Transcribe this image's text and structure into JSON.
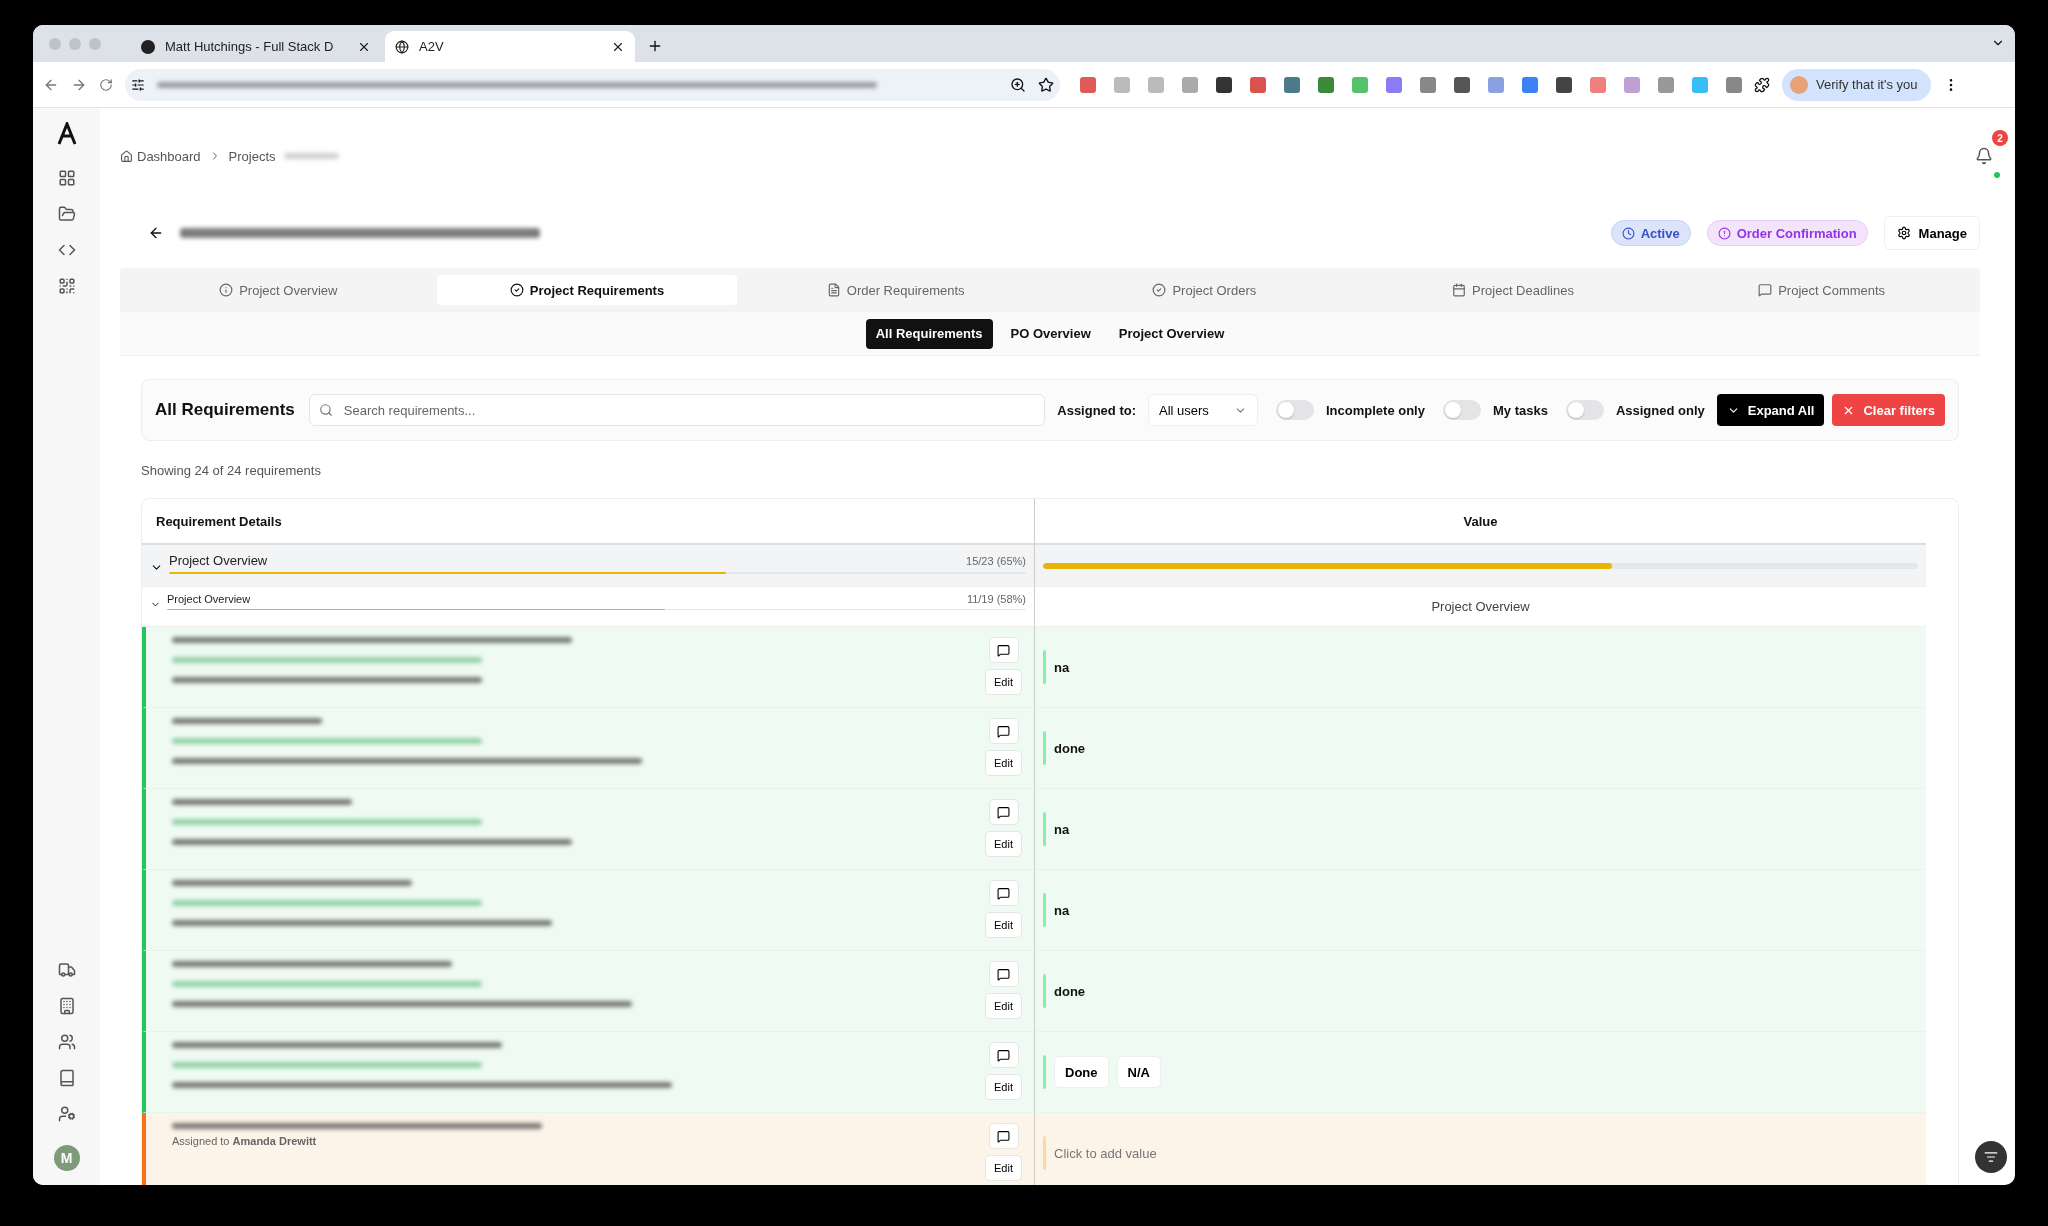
{
  "browser": {
    "tabs": [
      {
        "title": "Matt Hutchings - Full Stack D",
        "selected": false
      },
      {
        "title": "A2V",
        "selected": true
      }
    ],
    "profile_button": "Verify that it's you"
  },
  "sidebar": {
    "avatar": "M"
  },
  "breadcrumb": [
    "Dashboard",
    "Projects"
  ],
  "notifications": {
    "count": "2"
  },
  "badges": [
    {
      "label": "Active",
      "kind": "status"
    },
    {
      "label": "Order Confirmation",
      "kind": "stage"
    }
  ],
  "manage_button": "Manage",
  "tabs": [
    {
      "label": "Project Overview",
      "selected": false,
      "kind": "info"
    },
    {
      "label": "Project Requirements",
      "selected": true,
      "kind": "check"
    },
    {
      "label": "Order Requirements",
      "selected": false,
      "kind": "file"
    },
    {
      "label": "Project Orders",
      "selected": false,
      "kind": "check"
    },
    {
      "label": "Project Deadlines",
      "selected": false,
      "kind": "calendar"
    },
    {
      "label": "Project Comments",
      "selected": false,
      "kind": "comment"
    }
  ],
  "subtabs": [
    {
      "label": "All Requirements",
      "selected": true
    },
    {
      "label": "PO Overview",
      "selected": false
    },
    {
      "label": "Project Overview",
      "selected": false
    }
  ],
  "filter": {
    "title": "All Requirements",
    "search": {
      "placeholder": "Search requirements..."
    },
    "assigned_label": "Assigned to:",
    "assigned_value": "All users",
    "toggles": [
      {
        "label": "Incomplete only",
        "on": false
      },
      {
        "label": "My tasks",
        "on": false
      },
      {
        "label": "Assigned only",
        "on": false
      }
    ],
    "expand_button": "Expand All",
    "clear_button": "Clear filters"
  },
  "summary": "Showing 24 of 24 requirements",
  "table": {
    "columns": [
      "Requirement Details",
      "Value"
    ],
    "group": {
      "title": "Project Overview",
      "count": "15/23 (65%)",
      "level": 0.65,
      "expanded": true
    },
    "subgroup": {
      "title": "Project Overview",
      "count": "11/19 (58%)",
      "level": 0.58,
      "expanded": true,
      "value_label": "Project Overview"
    },
    "rows": [
      {
        "complete": true,
        "kind": "text",
        "value": "na",
        "edit": "Edit"
      },
      {
        "complete": true,
        "kind": "text",
        "value": "done",
        "edit": "Edit"
      },
      {
        "complete": true,
        "kind": "text",
        "value": "na",
        "edit": "Edit"
      },
      {
        "complete": true,
        "kind": "text",
        "value": "na",
        "edit": "Edit"
      },
      {
        "complete": true,
        "kind": "text",
        "value": "done",
        "edit": "Edit"
      },
      {
        "complete": true,
        "kind": "choices",
        "options": [
          "Done",
          "N/A"
        ],
        "edit": "Edit"
      },
      {
        "complete": false,
        "kind": "empty",
        "placeholder": "Click to add value",
        "assigned_label": "Assigned to",
        "assignee": "Amanda Drewitt",
        "edit": "Edit"
      }
    ]
  }
}
